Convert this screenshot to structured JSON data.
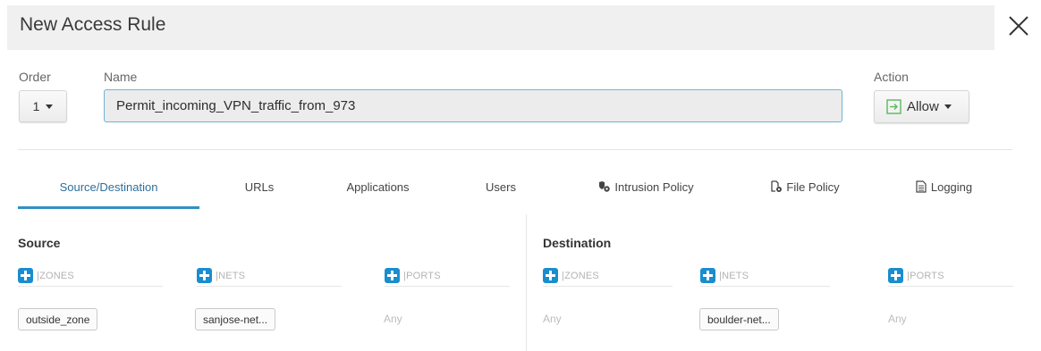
{
  "dialog": {
    "title": "New Access Rule"
  },
  "form": {
    "order_label": "Order",
    "order_value": "1",
    "name_label": "Name",
    "name_value": "Permit_incoming_VPN_traffic_from_973",
    "action_label": "Action",
    "action_value": "Allow"
  },
  "tabs": [
    {
      "label": "Source/Destination",
      "active": true
    },
    {
      "label": "URLs",
      "active": false
    },
    {
      "label": "Applications",
      "active": false
    },
    {
      "label": "Users",
      "active": false
    },
    {
      "label": "Intrusion Policy",
      "icon": "shield-gear-icon",
      "active": false
    },
    {
      "label": "File Policy",
      "icon": "file-gear-icon",
      "active": false
    },
    {
      "label": "Logging",
      "icon": "document-icon",
      "active": false
    }
  ],
  "source": {
    "title": "Source",
    "columns": [
      {
        "label": "ZONES",
        "value": "outside_zone",
        "type": "chip"
      },
      {
        "label": "NETS",
        "value": "sanjose-net...",
        "type": "chip"
      },
      {
        "label": "PORTS",
        "value": "Any",
        "type": "any"
      }
    ]
  },
  "destination": {
    "title": "Destination",
    "columns": [
      {
        "label": "ZONES",
        "value": "Any",
        "type": "any"
      },
      {
        "label": "NETS",
        "value": "boulder-net...",
        "type": "chip"
      },
      {
        "label": "PORTS",
        "value": "Any",
        "type": "any"
      }
    ]
  },
  "colors": {
    "accent": "#2f8fc6",
    "add_button": "#1a8dcf",
    "allow_icon": "#5cb85c"
  }
}
